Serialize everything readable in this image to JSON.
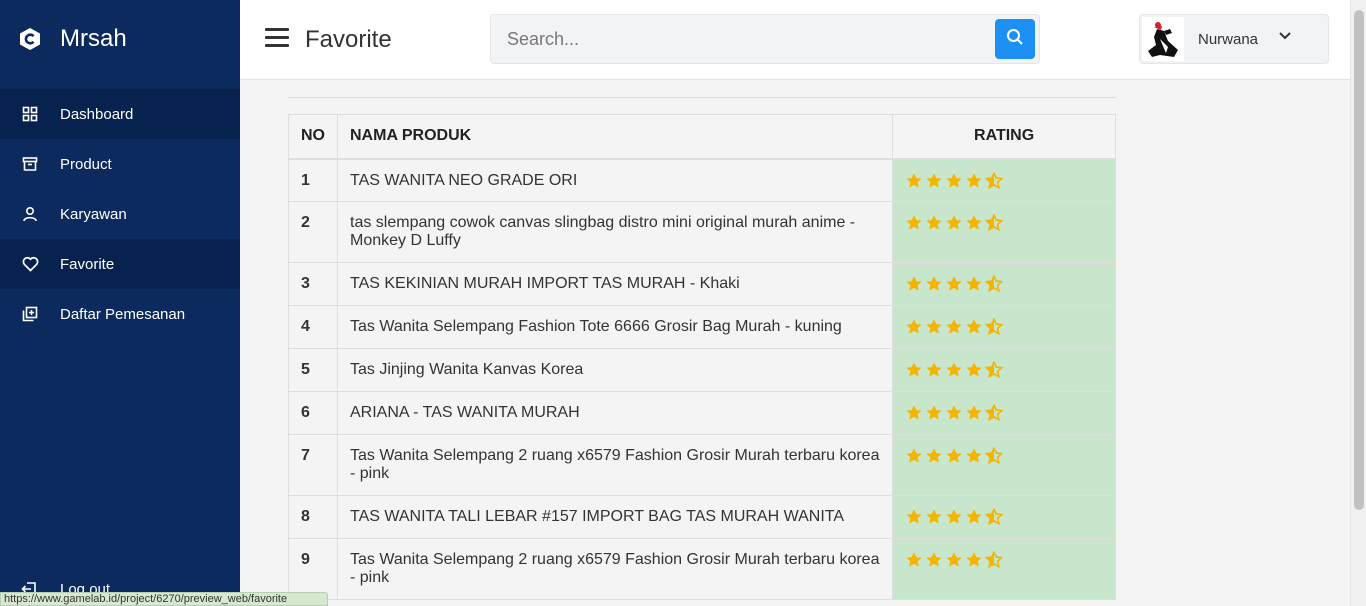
{
  "app": {
    "name": "Mrsah"
  },
  "sidebar": {
    "items": [
      {
        "label": "Dashboard",
        "icon": "grid-icon"
      },
      {
        "label": "Product",
        "icon": "archive-icon"
      },
      {
        "label": "Karyawan",
        "icon": "user-icon"
      },
      {
        "label": "Favorite",
        "icon": "heart-icon"
      },
      {
        "label": "Daftar Pemesanan",
        "icon": "add-list-icon"
      }
    ],
    "logout_label": "Log out"
  },
  "header": {
    "title": "Favorite",
    "search_placeholder": "Search...",
    "user_name": "Nurwana"
  },
  "table": {
    "headers": {
      "no": "NO",
      "name": "NAMA PRODUK",
      "rating": "RATING"
    },
    "rows": [
      {
        "no": "1",
        "name": "TAS WANITA NEO GRADE ORI",
        "rating": 4.5
      },
      {
        "no": "2",
        "name": "tas slempang cowok canvas slingbag distro mini original murah anime - Monkey D Luffy",
        "rating": 4.5
      },
      {
        "no": "3",
        "name": "TAS KEKINIAN MURAH IMPORT TAS MURAH - Khaki",
        "rating": 4.5
      },
      {
        "no": "4",
        "name": "Tas Wanita Selempang Fashion Tote 6666 Grosir Bag Murah - kuning",
        "rating": 4.5
      },
      {
        "no": "5",
        "name": "Tas Jinjing Wanita Kanvas Korea",
        "rating": 4.5
      },
      {
        "no": "6",
        "name": "ARIANA - TAS WANITA MURAH",
        "rating": 4.5
      },
      {
        "no": "7",
        "name": "Tas Wanita Selempang 2 ruang x6579 Fashion Grosir Murah terbaru korea - pink",
        "rating": 4.5
      },
      {
        "no": "8",
        "name": "TAS WANITA TALI LEBAR #157 IMPORT BAG TAS MURAH WANITA",
        "rating": 4.5
      },
      {
        "no": "9",
        "name": "Tas Wanita Selempang 2 ruang x6579 Fashion Grosir Murah terbaru korea - pink",
        "rating": 4.5
      }
    ]
  },
  "status_url": "https://www.gamelab.id/project/6270/preview_web/favorite",
  "colors": {
    "sidebar": "#0c2a5e",
    "accent": "#1e90f3",
    "star": "#f5b400",
    "rating_bg": "#c7e6cb"
  }
}
